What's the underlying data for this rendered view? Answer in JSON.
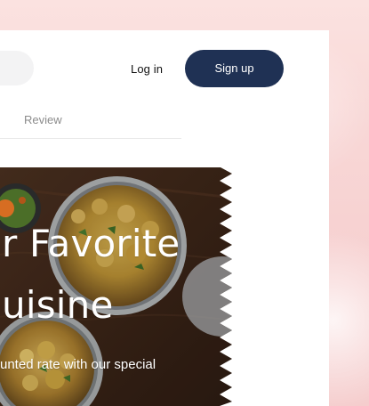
{
  "header": {
    "login_label": "Log in",
    "signup_label": "Sign up"
  },
  "tabs": {
    "items": [
      {
        "label": "Review"
      }
    ]
  },
  "hero": {
    "title_line_1": "r Favorite",
    "title_line_2": "uisine",
    "subtext": "unted rate with our special"
  },
  "theme": {
    "accent": "#1F3154",
    "card_bg": "#FFFFFF",
    "page_bg": "#F8D7D6",
    "muted_text": "#8C8C8C",
    "hero_text": "#FFFFFF"
  },
  "icons": {
    "search_shape": "search-pill"
  }
}
